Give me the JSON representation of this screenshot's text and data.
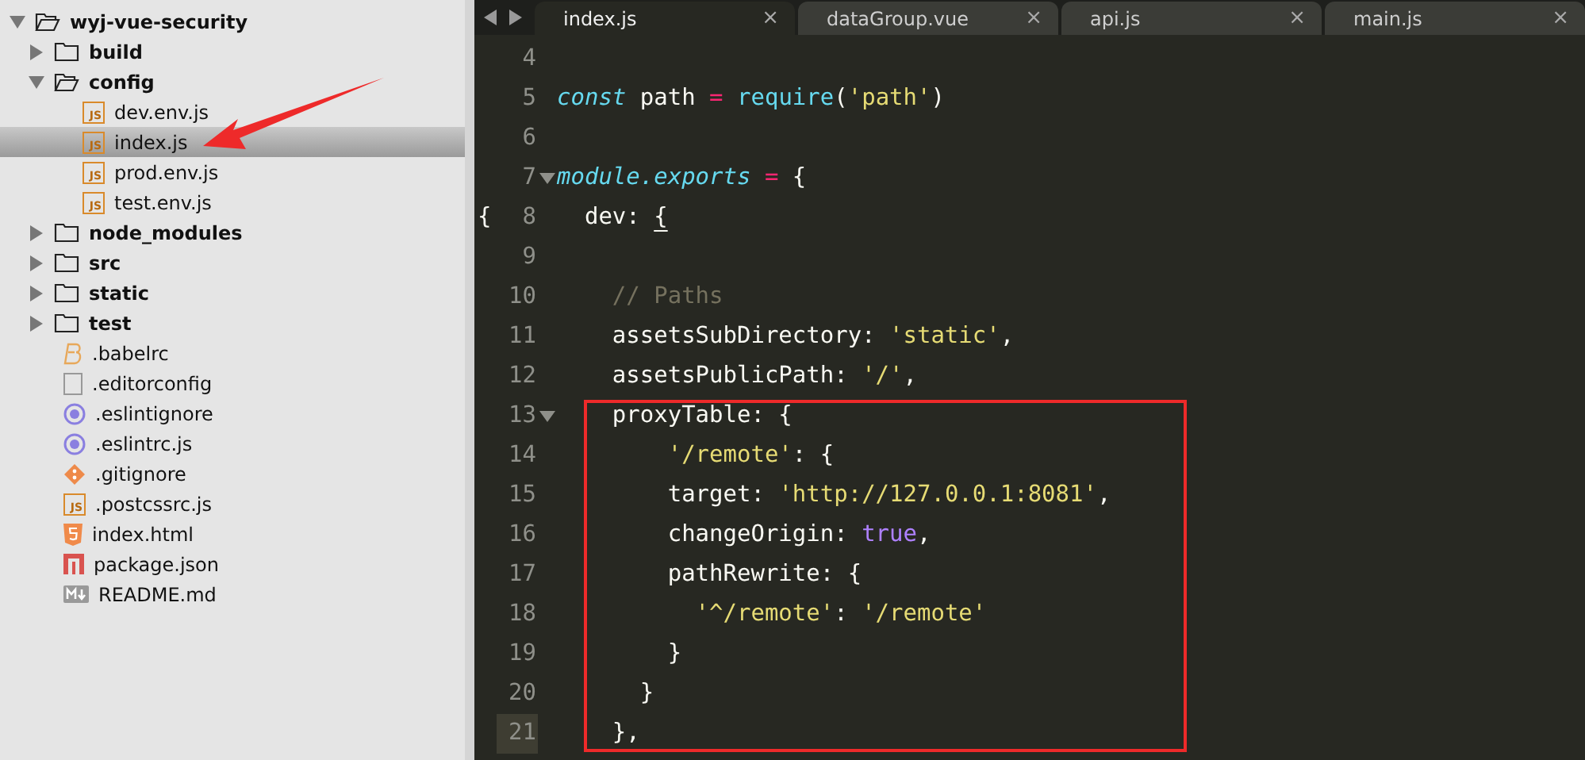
{
  "sidebar": {
    "tree": [
      {
        "label": "wyj-vue-security",
        "kind": "folder",
        "expanded": true,
        "selected": false,
        "children": [
          {
            "label": "build",
            "kind": "folder",
            "expanded": false,
            "selected": false
          },
          {
            "label": "config",
            "kind": "folder",
            "expanded": true,
            "selected": false,
            "children": [
              {
                "label": "dev.env.js",
                "kind": "js",
                "icon_text": "JS",
                "selected": false
              },
              {
                "label": "index.js",
                "kind": "js",
                "icon_text": "JS",
                "selected": true
              },
              {
                "label": "prod.env.js",
                "kind": "js",
                "icon_text": "JS",
                "selected": false
              },
              {
                "label": "test.env.js",
                "kind": "js",
                "icon_text": "JS",
                "selected": false
              }
            ]
          },
          {
            "label": "node_modules",
            "kind": "folder",
            "expanded": false,
            "selected": false
          },
          {
            "label": "src",
            "kind": "folder",
            "expanded": false,
            "selected": false
          },
          {
            "label": "static",
            "kind": "folder",
            "expanded": false,
            "selected": false
          },
          {
            "label": "test",
            "kind": "folder",
            "expanded": false,
            "selected": false
          },
          {
            "label": ".babelrc",
            "kind": "babel",
            "selected": false
          },
          {
            "label": ".editorconfig",
            "kind": "plain",
            "selected": false
          },
          {
            "label": ".eslintignore",
            "kind": "eslint",
            "selected": false
          },
          {
            "label": ".eslintrc.js",
            "kind": "eslint",
            "selected": false
          },
          {
            "label": ".gitignore",
            "kind": "git",
            "selected": false
          },
          {
            "label": ".postcssrc.js",
            "kind": "js",
            "icon_text": "JS",
            "selected": false
          },
          {
            "label": "index.html",
            "kind": "html",
            "selected": false
          },
          {
            "label": "package.json",
            "kind": "npm",
            "selected": false
          },
          {
            "label": "README.md",
            "kind": "md",
            "selected": false
          }
        ]
      }
    ]
  },
  "tabs": [
    {
      "label": "index.js",
      "selected": true,
      "close": "×"
    },
    {
      "label": "dataGroup.vue",
      "selected": false,
      "close": "×"
    },
    {
      "label": "api.js",
      "selected": false,
      "close": "×"
    },
    {
      "label": "main.js",
      "selected": false,
      "close": "×"
    }
  ],
  "editor": {
    "lines": [
      {
        "number": "4"
      },
      {
        "number": "5",
        "tokens": [
          {
            "kind": "keyword",
            "text": "const"
          },
          {
            "kind": "plain",
            "text": " path"
          },
          {
            "kind": "operator",
            "text": " = "
          },
          {
            "kind": "function",
            "text": "require"
          },
          {
            "kind": "plain",
            "text": "("
          },
          {
            "kind": "string",
            "text": "'path'"
          },
          {
            "kind": "plain",
            "text": ")"
          }
        ]
      },
      {
        "number": "6"
      },
      {
        "number": "7",
        "fold": true,
        "tokens": [
          {
            "kind": "keyword",
            "text": "module.exports"
          },
          {
            "kind": "operator",
            "text": " = "
          },
          {
            "kind": "plain",
            "text": "{"
          }
        ]
      },
      {
        "number": "8",
        "gutter_mark": "{",
        "tokens": [
          {
            "kind": "plain",
            "text": "  dev: "
          },
          {
            "kind": "bracket",
            "text": "{"
          }
        ]
      },
      {
        "number": "9"
      },
      {
        "number": "10",
        "tokens": [
          {
            "kind": "comment",
            "text": "    // Paths"
          }
        ]
      },
      {
        "number": "11",
        "tokens": [
          {
            "kind": "plain",
            "text": "    assetsSubDirectory: "
          },
          {
            "kind": "string",
            "text": "'static'"
          },
          {
            "kind": "plain",
            "text": ","
          }
        ]
      },
      {
        "number": "12",
        "tokens": [
          {
            "kind": "plain",
            "text": "    assetsPublicPath: "
          },
          {
            "kind": "string",
            "text": "'/'"
          },
          {
            "kind": "plain",
            "text": ","
          }
        ]
      },
      {
        "number": "13",
        "fold": true,
        "tokens": [
          {
            "kind": "plain",
            "text": "    proxyTable: {"
          }
        ]
      },
      {
        "number": "14",
        "tokens": [
          {
            "kind": "string",
            "text": "        '/remote'"
          },
          {
            "kind": "plain",
            "text": ": {"
          }
        ]
      },
      {
        "number": "15",
        "tokens": [
          {
            "kind": "plain",
            "text": "        target: "
          },
          {
            "kind": "string",
            "text": "'http://127.0.0.1:8081'"
          },
          {
            "kind": "plain",
            "text": ","
          }
        ]
      },
      {
        "number": "16",
        "tokens": [
          {
            "kind": "plain",
            "text": "        changeOrigin: "
          },
          {
            "kind": "constant",
            "text": "true"
          },
          {
            "kind": "plain",
            "text": ","
          }
        ]
      },
      {
        "number": "17",
        "tokens": [
          {
            "kind": "plain",
            "text": "        pathRewrite: {"
          }
        ]
      },
      {
        "number": "18",
        "tokens": [
          {
            "kind": "string",
            "text": "          '^/remote'"
          },
          {
            "kind": "plain",
            "text": ": "
          },
          {
            "kind": "string",
            "text": "'/remote'"
          }
        ]
      },
      {
        "number": "19",
        "tokens": [
          {
            "kind": "plain",
            "text": "        }"
          }
        ]
      },
      {
        "number": "20",
        "tokens": [
          {
            "kind": "plain",
            "text": "      }"
          }
        ]
      },
      {
        "number": "21",
        "current": true,
        "tokens": [
          {
            "kind": "plain",
            "text": "    },"
          }
        ]
      }
    ]
  }
}
